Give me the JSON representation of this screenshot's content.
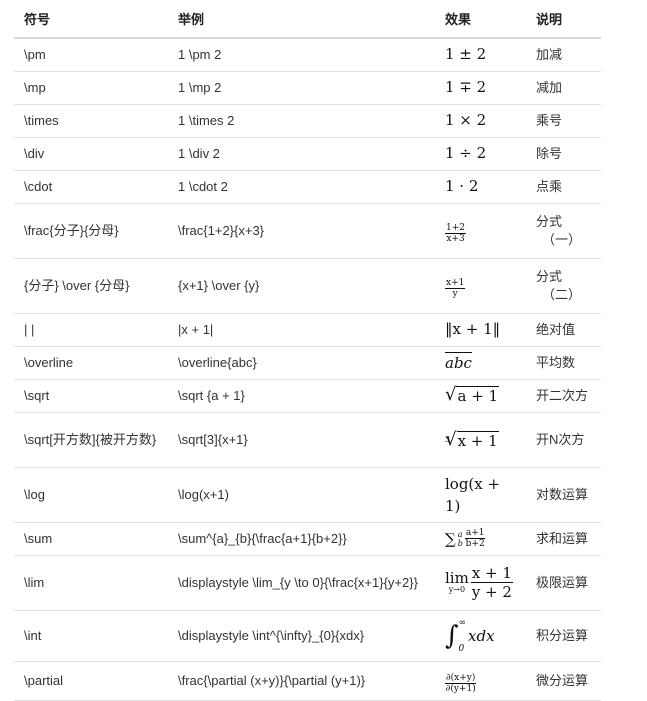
{
  "headers": [
    "符号",
    "举例",
    "效果",
    "说明"
  ],
  "rows": [
    {
      "symbol": "\\pm",
      "example": "1 \\pm 2",
      "effect": "1 ± 2",
      "desc": "加减"
    },
    {
      "symbol": "\\mp",
      "example": "1 \\mp 2",
      "effect": "1 ∓ 2",
      "desc": "减加"
    },
    {
      "symbol": "\\times",
      "example": "1 \\times 2",
      "effect": "1 × 2",
      "desc": "乘号"
    },
    {
      "symbol": "\\div",
      "example": "1 \\div 2",
      "effect": "1 ÷ 2",
      "desc": "除号"
    },
    {
      "symbol": "\\cdot",
      "example": "1 \\cdot 2",
      "effect": "1 · 2",
      "desc": "点乘"
    },
    {
      "symbol": "\\frac{分子}{分母}",
      "example": "\\frac{1+2}{x+3}",
      "effect": {
        "num": "1+2",
        "den": "x+3"
      },
      "desc": "分式",
      "desc2": "（一）"
    },
    {
      "symbol": "{分子} \\over {分母}",
      "example": "{x+1} \\over {y}",
      "effect": {
        "num": "x+1",
        "den": "y"
      },
      "desc": "分式",
      "desc2": "（二）"
    },
    {
      "symbol": "| |",
      "example": "|x + 1|",
      "effect": "‖x + 1‖",
      "desc": "绝对值"
    },
    {
      "symbol": "\\overline",
      "example": "\\overline{abc}",
      "effect": "abc",
      "desc": "平均数"
    },
    {
      "symbol": "\\sqrt",
      "example": "\\sqrt {a + 1}",
      "effect": "a + 1",
      "desc": "开二次方"
    },
    {
      "symbol": "\\sqrt[开方数]{被开方数}",
      "example": "\\sqrt[3]{x+1}",
      "effect": {
        "index": "3",
        "body": "x + 1"
      },
      "desc": "开N次方"
    },
    {
      "symbol": "\\log",
      "example": "\\log(x+1)",
      "effect": {
        "line1": "log(x +",
        "line2": "1)"
      },
      "desc": "对数运算"
    },
    {
      "symbol": "\\sum",
      "example": "\\sum^{a}_{b}{\\frac{a+1}{b+2}}",
      "effect": {
        "sup": "a",
        "sub": "b",
        "num": "a+1",
        "den": "b+2"
      },
      "desc": "求和运算"
    },
    {
      "symbol": "\\lim",
      "example": "\\displaystyle \\lim_{y \\to 0}{\\frac{x+1}{y+2}}",
      "effect": {
        "sub": "y→0",
        "num": "x + 1",
        "den": "y + 2"
      },
      "desc": "极限运算"
    },
    {
      "symbol": "\\int",
      "example": "\\displaystyle \\int^{\\infty}_{0}{xdx}",
      "effect": {
        "sup": "∞",
        "sub": "0",
        "body": "xdx"
      },
      "desc": "积分运算"
    },
    {
      "symbol": "\\partial",
      "example": "\\frac{\\partial (x+y)}{\\partial (y+1)}",
      "effect": {
        "num": "∂(x+y)",
        "den": "∂(y+1)"
      },
      "desc": "微分运算"
    }
  ]
}
